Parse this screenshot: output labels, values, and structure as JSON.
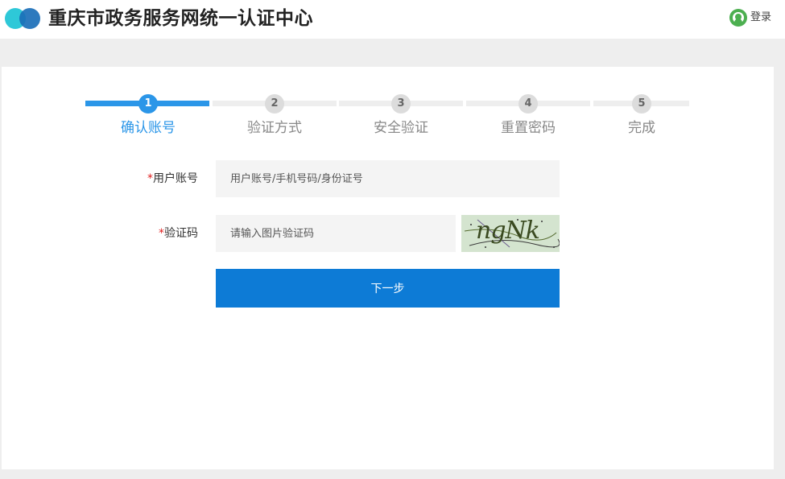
{
  "header": {
    "title": "重庆市政务服务网统一认证中心",
    "login_label": "登录"
  },
  "steps": [
    {
      "num": "1",
      "label": "确认账号"
    },
    {
      "num": "2",
      "label": "验证方式"
    },
    {
      "num": "3",
      "label": "安全验证"
    },
    {
      "num": "4",
      "label": "重置密码"
    },
    {
      "num": "5",
      "label": "完成"
    }
  ],
  "form": {
    "required_mark": "*",
    "account_label": "用户账号",
    "account_placeholder": "用户账号/手机号码/身份证号",
    "captcha_label": "验证码",
    "captcha_placeholder": "请输入图片验证码",
    "captcha_text": "ngNk",
    "next_label": "下一步"
  },
  "colors": {
    "accent": "#2b96e8",
    "button": "#0d7bd6",
    "required": "#e02020"
  }
}
